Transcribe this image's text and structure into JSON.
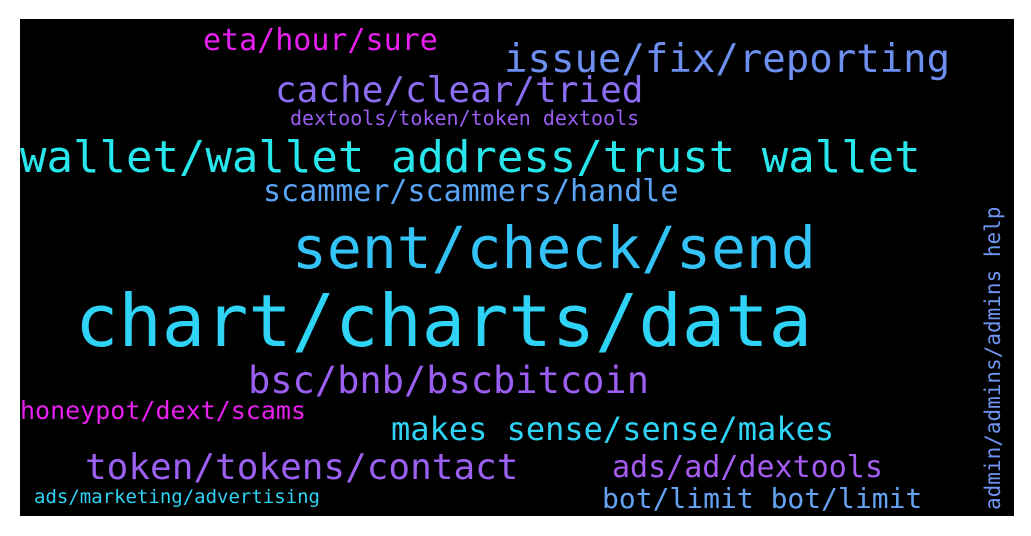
{
  "words": [
    {
      "text": "chart/charts/data",
      "color": "#2ed3f5"
    },
    {
      "text": "sent/check/send",
      "color": "#33c3f7"
    },
    {
      "text": "wallet/wallet address/trust wallet",
      "color": "#27e6ec"
    },
    {
      "text": "issue/fix/reporting",
      "color": "#6c8ff0"
    },
    {
      "text": "cache/clear/tried",
      "color": "#8b6df2"
    },
    {
      "text": "bsc/bnb/bscbitcoin",
      "color": "#9b5ef2"
    },
    {
      "text": "token/tokens/contact",
      "color": "#9b60f2"
    },
    {
      "text": "makes sense/sense/makes",
      "color": "#2ed3f5"
    },
    {
      "text": "ads/ad/dextools",
      "color": "#a55cf2"
    },
    {
      "text": "scammer/scammers/handle",
      "color": "#5aa5f5"
    },
    {
      "text": "eta/hour/sure",
      "color": "#e81ff0"
    },
    {
      "text": "honeypot/dext/scams",
      "color": "#e81ff0"
    },
    {
      "text": "bot/limit bot/limit",
      "color": "#64a2f2"
    },
    {
      "text": "dextools/token/token dextools",
      "color": "#9a5df2"
    },
    {
      "text": "ads/marketing/advertising",
      "color": "#2ed3f5"
    },
    {
      "text": "admin/admins/admins help",
      "color": "#6f94f2"
    }
  ]
}
